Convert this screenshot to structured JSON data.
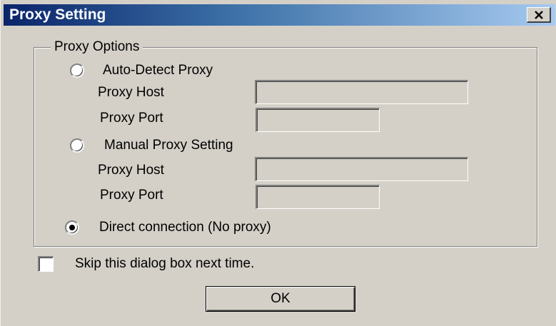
{
  "window": {
    "title": "Proxy Setting",
    "close_icon": "close-icon"
  },
  "proxy_options": {
    "legend": "Proxy Options",
    "auto_detect": {
      "label": "Auto-Detect Proxy",
      "selected": false,
      "host_label": "Proxy Host",
      "host_value": "",
      "port_label": "Proxy Port",
      "port_value": ""
    },
    "manual": {
      "label": "Manual Proxy Setting",
      "selected": false,
      "host_label": "Proxy Host",
      "host_value": "",
      "port_label": "Proxy Port",
      "port_value": ""
    },
    "direct": {
      "label": "Direct connection (No proxy)",
      "selected": true
    }
  },
  "skip_dialog": {
    "label": "Skip this dialog box next time.",
    "checked": false
  },
  "ok_label": "OK",
  "colors": {
    "dialog_bg": "#d4d0c8",
    "title_bar_start": "#0a246a",
    "title_bar_end": "#a6caf0",
    "title_text": "#ffffff"
  }
}
